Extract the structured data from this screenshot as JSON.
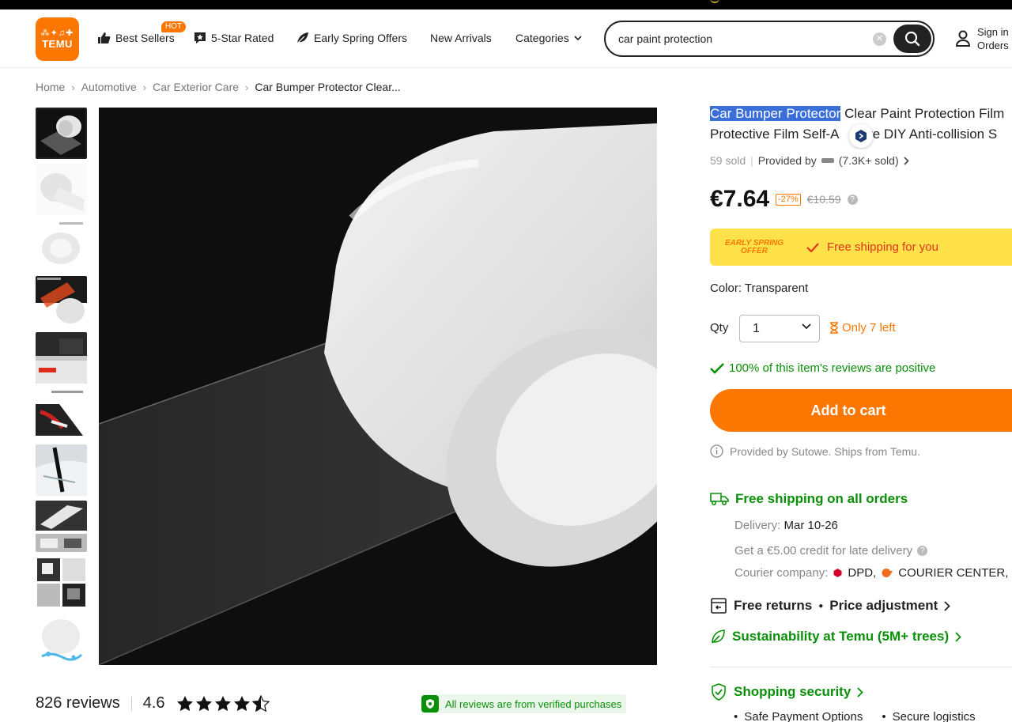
{
  "header": {
    "logo_text": "TEMU",
    "nav": {
      "best_sellers": "Best Sellers",
      "hot_badge": "HOT",
      "five_star": "5-Star Rated",
      "spring_offers": "Early Spring Offers",
      "new_arrivals": "New Arrivals",
      "categories": "Categories"
    },
    "search": {
      "value": "car paint protection"
    },
    "account": {
      "line1": "Sign in",
      "line2": "Orders"
    }
  },
  "breadcrumb": {
    "home": "Home",
    "automotive": "Automotive",
    "exterior": "Car Exterior Care",
    "current": "Car Bumper Protector Clear..."
  },
  "product": {
    "title_highlight": "Car Bumper Protector",
    "title_rest": " Clear Paint Protection Film",
    "title_line2a": "Protective Film Self-A",
    "title_line2b": "ive DIY Anti-collision S",
    "sold": "59 sold",
    "provided_by": "Provided by",
    "seller_sold": "(7.3K+ sold)",
    "price": "€7.64",
    "discount": "-27%",
    "original_price": "€10.59",
    "banner_badge_1": "EARLY SPRING",
    "banner_badge_2": "OFFER",
    "banner_text": "Free shipping for you",
    "color_line": "Color: Transparent",
    "qty_label": "Qty",
    "qty_value": "1",
    "stock": "Only 7 left",
    "positive": "100% of this item's reviews are positive",
    "add_to_cart": "Add to cart",
    "provided_note": "Provided by Sutowe. Ships from Temu."
  },
  "shipping": {
    "free_all": "Free shipping on all orders",
    "delivery_label": "Delivery:",
    "delivery_date": "Mar 10-26",
    "credit": "Get a €5.00 credit for late delivery",
    "courier_label": "Courier company:",
    "courier_1": "DPD,",
    "courier_2": "COURIER CENTER,",
    "returns": "Free returns",
    "price_adj": "Price adjustment",
    "sustainability": "Sustainability at Temu (5M+ trees)",
    "security": "Shopping security",
    "sec_item_1": "Safe Payment Options",
    "sec_item_2": "Secure logistics"
  },
  "reviews": {
    "count": "826 reviews",
    "rating": "4.6",
    "rating_value": 4.6,
    "verified": "All reviews are from verified purchases"
  },
  "colors": {
    "brand_orange": "#fb7701",
    "green": "#0a8f08",
    "banner_yellow": "#ffe14a"
  }
}
